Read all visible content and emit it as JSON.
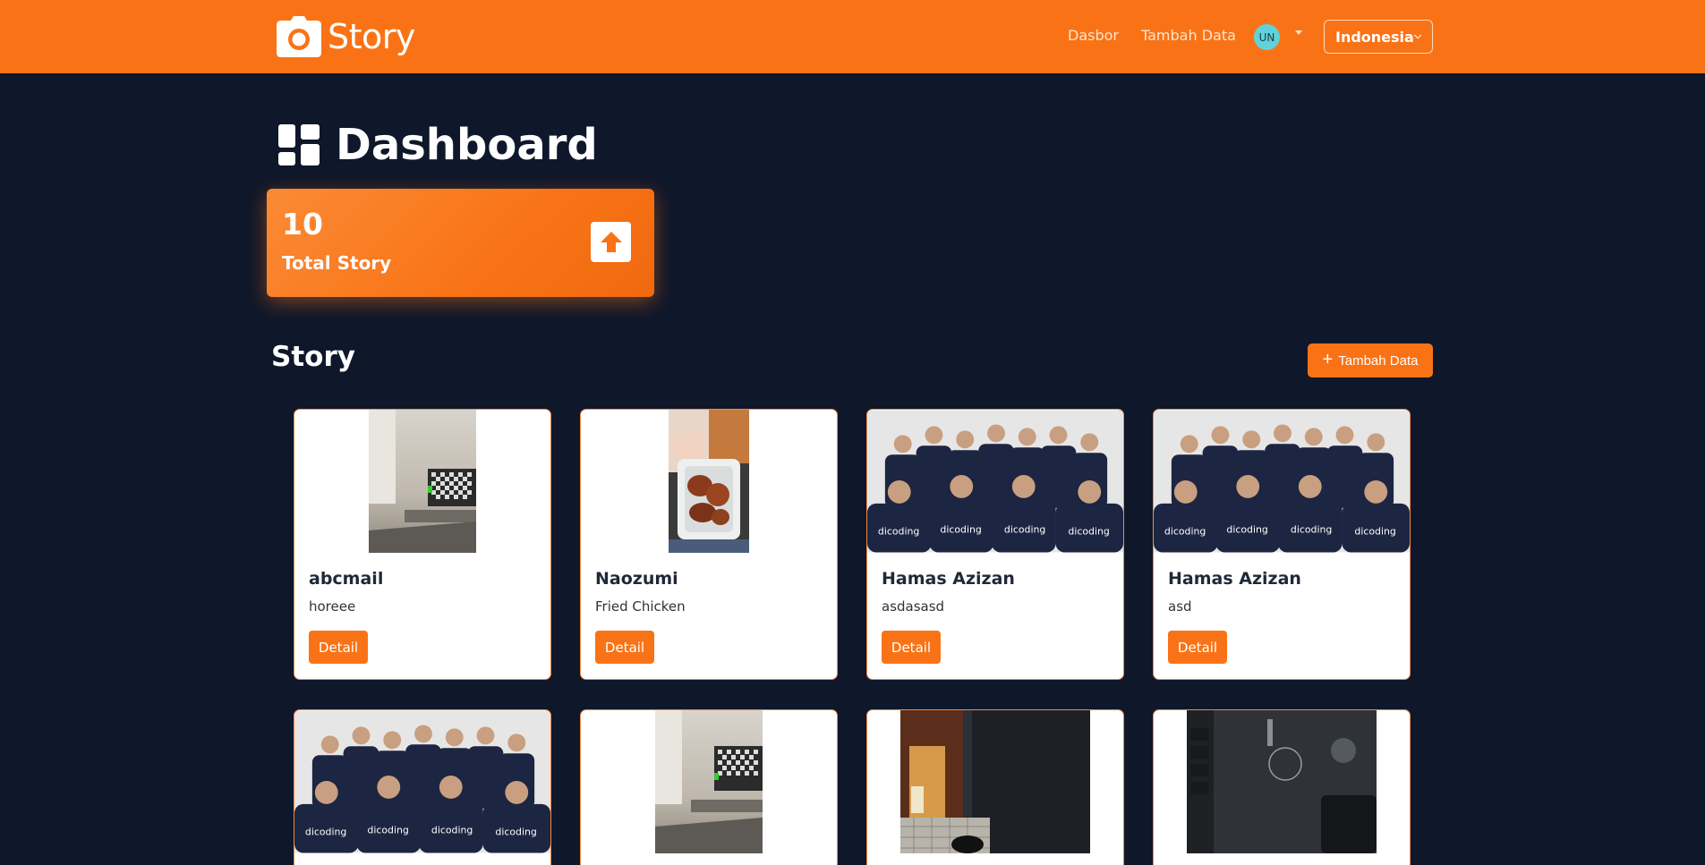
{
  "brand": {
    "name": "Story"
  },
  "nav": {
    "links": [
      {
        "label": "Dasbor"
      },
      {
        "label": "Tambah Data"
      }
    ],
    "avatar_initials": "UN",
    "language": "Indonesia"
  },
  "dashboard": {
    "title": "Dashboard",
    "stat": {
      "value": "10",
      "label": "Total Story"
    }
  },
  "stories": {
    "title": "Story",
    "add_label": "Tambah Data",
    "detail_label": "Detail",
    "items": [
      {
        "name": "abcmail",
        "description": "horeee",
        "image": "living-room-tv"
      },
      {
        "name": "Naozumi",
        "description": "Fried Chicken",
        "image": "fried-chicken"
      },
      {
        "name": "Hamas Azizan",
        "description": "asdasasd",
        "image": "group-photo"
      },
      {
        "name": "Hamas Azizan",
        "description": "asd",
        "image": "group-photo"
      },
      {
        "name": "",
        "description": "",
        "image": "group-photo"
      },
      {
        "name": "",
        "description": "",
        "image": "living-room-tv"
      },
      {
        "name": "",
        "description": "",
        "image": "dark-object-closeup"
      },
      {
        "name": "",
        "description": "",
        "image": "dark-device-closeup"
      }
    ]
  },
  "colors": {
    "primary": "#f97316",
    "background": "#0f172a",
    "card_border": "#f58a4a"
  }
}
